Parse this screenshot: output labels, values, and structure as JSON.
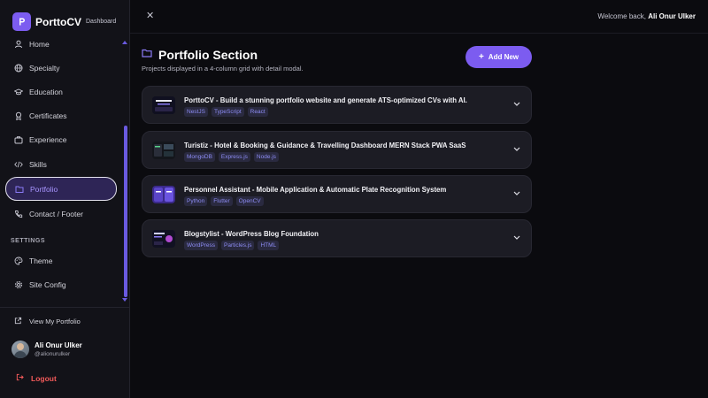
{
  "brand": {
    "name": "PorttoCV",
    "tag": "Dashboard",
    "accent": "#7c5cf0"
  },
  "sidebar": {
    "items": [
      {
        "label": "Home",
        "icon": "user-icon"
      },
      {
        "label": "Specialty",
        "icon": "globe-icon"
      },
      {
        "label": "Education",
        "icon": "graduation-cap-icon"
      },
      {
        "label": "Certificates",
        "icon": "award-icon"
      },
      {
        "label": "Experience",
        "icon": "briefcase-icon"
      },
      {
        "label": "Skills",
        "icon": "code-icon"
      },
      {
        "label": "Portfolio",
        "icon": "folder-icon",
        "active": true
      },
      {
        "label": "Contact / Footer",
        "icon": "contact-icon"
      }
    ],
    "settings_label": "SETTINGS",
    "settings_items": [
      {
        "label": "Theme",
        "icon": "palette-icon"
      },
      {
        "label": "Site Config",
        "icon": "gear-icon"
      }
    ],
    "view_portfolio": "View My Portfolio",
    "user": {
      "name": "Ali Onur Ulker",
      "handle": "@alionurulker"
    },
    "logout": "Logout"
  },
  "topbar": {
    "close_label": "✕",
    "welcome_prefix": "Welcome back,",
    "welcome_name": "Ali Onur Ulker"
  },
  "main": {
    "title": "Portfolio Section",
    "subtitle": "Projects displayed in a 4-column grid with detail modal.",
    "add_label": "Add New",
    "projects": [
      {
        "title": "PorttoCV - Build a stunning portfolio website and generate ATS-optimized CVs with AI.",
        "tags": [
          "NestJS",
          "TypeScript",
          "React"
        ]
      },
      {
        "title": "Turistiz - Hotel & Booking & Guidance & Travelling Dashboard MERN Stack PWA SaaS",
        "tags": [
          "MongoDB",
          "Express.js",
          "Node.js"
        ]
      },
      {
        "title": "Personnel Assistant - Mobile Application & Automatic Plate Recognition System",
        "tags": [
          "Python",
          "Flutter",
          "OpenCV"
        ]
      },
      {
        "title": "Blogstylist - WordPress Blog Foundation",
        "tags": [
          "WordPress",
          "Particles.js",
          "HTML"
        ]
      }
    ]
  }
}
